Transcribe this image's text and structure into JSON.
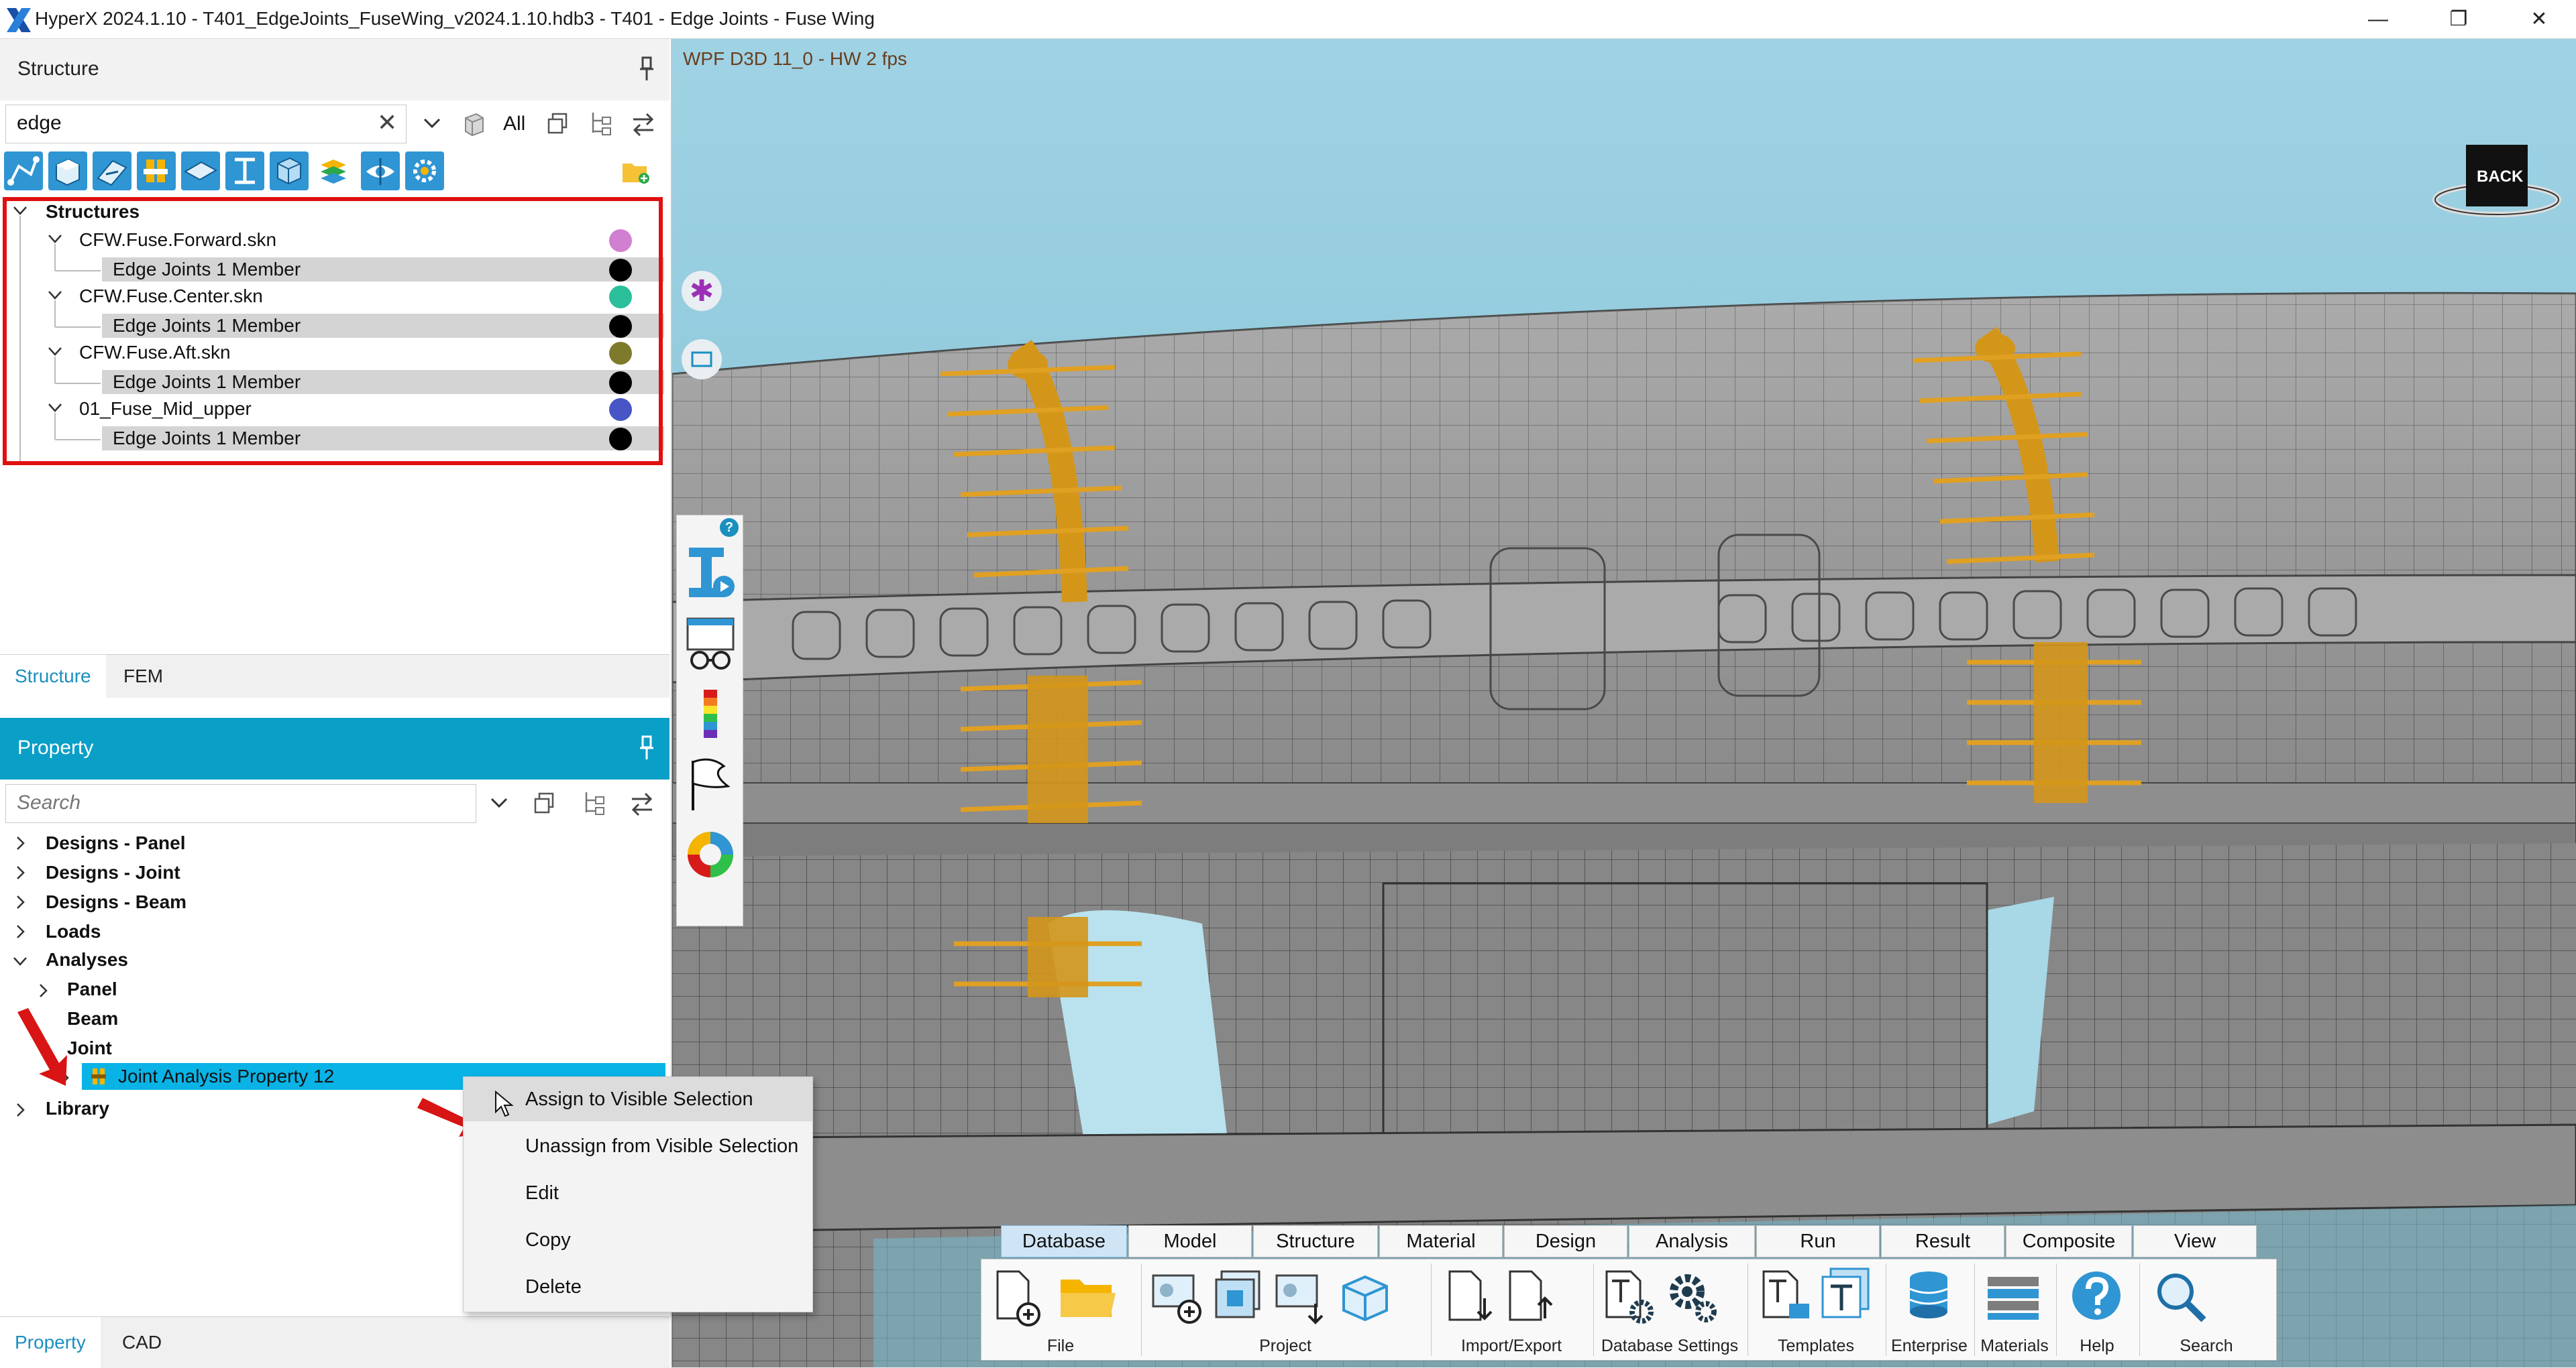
{
  "window": {
    "title": "HyperX 2024.1.10 - T401_EdgeJoints_FuseWing_v2024.1.10.hdb3 - T401 - Edge Joints - Fuse Wing",
    "minimize_glyph": "—",
    "maximize_glyph": "❐",
    "close_glyph": "✕"
  },
  "structure_panel": {
    "title": "Structure",
    "search_value": "edge",
    "filter_label": "All",
    "tree": {
      "root": "Structures",
      "groups": [
        {
          "name": "CFW.Fuse.Forward.skn",
          "color": "#d17fd0",
          "member": "Edge Joints 1 Member"
        },
        {
          "name": "CFW.Fuse.Center.skn",
          "color": "#2bbf9b",
          "member": "Edge Joints 1 Member"
        },
        {
          "name": "CFW.Fuse.Aft.skn",
          "color": "#7e7a2c",
          "member": "Edge Joints 1 Member"
        },
        {
          "name": "01_Fuse_Mid_upper",
          "color": "#4756c4",
          "member": "Edge Joints 1 Member"
        }
      ]
    },
    "tabs": [
      "Structure",
      "FEM"
    ]
  },
  "property_panel": {
    "title": "Property",
    "search_placeholder": "Search",
    "tree": {
      "designs_panel": "Designs - Panel",
      "designs_joint": "Designs - Joint",
      "designs_beam": "Designs - Beam",
      "loads": "Loads",
      "analyses": "Analyses",
      "panel": "Panel",
      "beam": "Beam",
      "joint": "Joint",
      "selected_property": "Joint Analysis Property 12",
      "library": "Library"
    },
    "tabs": [
      "Property",
      "CAD"
    ]
  },
  "viewport": {
    "label": "WPF D3D 11_0 - HW  2 fps",
    "back_label": "BACK",
    "help_badge": "?"
  },
  "context_menu": {
    "items": [
      "Assign to Visible Selection",
      "Unassign from Visible Selection",
      "Edit",
      "Copy",
      "Delete"
    ]
  },
  "ribbon": {
    "tabs": [
      "Database",
      "Model",
      "Structure",
      "Material",
      "Design",
      "Analysis",
      "Run",
      "Result",
      "Composite",
      "View"
    ],
    "active_tab": "Database",
    "groups": {
      "file": "File",
      "project": "Project",
      "import_export": "Import/Export",
      "database_settings": "Database Settings",
      "templates": "Templates",
      "enterprise": "Enterprise",
      "materials": "Materials",
      "help": "Help",
      "search": "Search"
    }
  },
  "colors": {
    "accent": "#0a9fc7",
    "selection": "#09b3e6",
    "highlight_box": "#e01010",
    "joint_orange": "#e0a022"
  }
}
